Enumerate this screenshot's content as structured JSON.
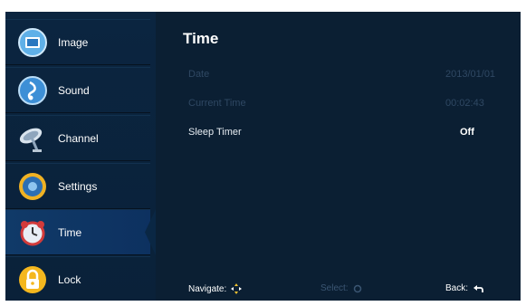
{
  "sidebar": {
    "items": [
      {
        "label": "Image",
        "icon": "image-icon"
      },
      {
        "label": "Sound",
        "icon": "sound-icon"
      },
      {
        "label": "Channel",
        "icon": "satellite-dish-icon"
      },
      {
        "label": "Settings",
        "icon": "settings-icon"
      },
      {
        "label": "Time",
        "icon": "alarm-clock-icon",
        "selected": true
      },
      {
        "label": "Lock",
        "icon": "lock-icon"
      }
    ]
  },
  "main": {
    "title": "Time",
    "rows": [
      {
        "label": "Date",
        "value": "2013/01/01",
        "enabled": false
      },
      {
        "label": "Current Time",
        "value": "00:02:43",
        "enabled": false
      },
      {
        "label": "Sleep Timer",
        "value": "Off",
        "enabled": true
      }
    ]
  },
  "footer": {
    "navigate": "Navigate:",
    "select": "Select:",
    "back": "Back:"
  },
  "colors": {
    "panel_bg": "#0b1f33",
    "sidebar_bg": "#0b2540",
    "selected_bg": "#103a68",
    "disabled_text": "#2f4863"
  }
}
